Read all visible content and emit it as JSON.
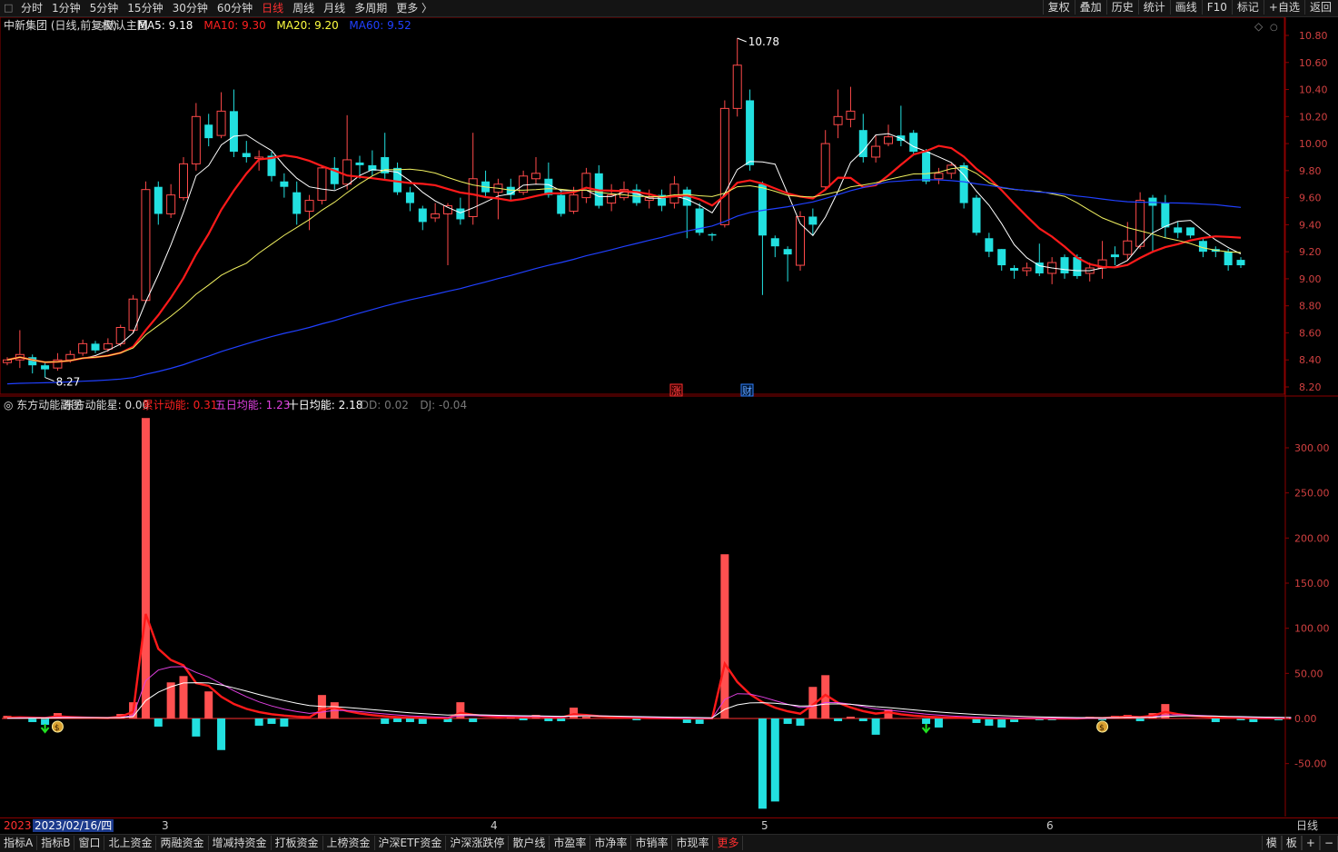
{
  "topbar": {
    "tabs": [
      {
        "label": "分时",
        "active": false
      },
      {
        "label": "1分钟",
        "active": false
      },
      {
        "label": "5分钟",
        "active": false
      },
      {
        "label": "15分钟",
        "active": false
      },
      {
        "label": "30分钟",
        "active": false
      },
      {
        "label": "60分钟",
        "active": false
      },
      {
        "label": "日线",
        "active": true
      },
      {
        "label": "周线",
        "active": false
      },
      {
        "label": "月线",
        "active": false
      },
      {
        "label": "多周期",
        "active": false
      },
      {
        "label": "更多 〉",
        "active": false
      }
    ],
    "right_buttons": [
      "复权",
      "叠加",
      "历史",
      "统计",
      "画线",
      "F10",
      "标记",
      "+自选",
      "返回"
    ]
  },
  "main_panel": {
    "stock_label": "中新集团 (日线,前复权)",
    "indicator_name": "默认主图",
    "ma": [
      {
        "label": "MA5: 9.18",
        "color": "#ffffff"
      },
      {
        "label": "MA10: 9.30",
        "color": "#ff2020"
      },
      {
        "label": "MA20: 9.20",
        "color": "#ffff40"
      },
      {
        "label": "MA60: 9.52",
        "color": "#2040ff"
      }
    ],
    "yaxis": [
      "10.80",
      "10.60",
      "10.40",
      "10.20",
      "10.00",
      "9.80",
      "9.60",
      "9.40",
      "9.20",
      "9.00",
      "8.80",
      "8.60",
      "8.40",
      "8.20"
    ],
    "high_label": "10.78",
    "low_label": "8.27",
    "event_badges": [
      "涨",
      "财"
    ]
  },
  "sub_panel": {
    "name": "东方动能副图",
    "values": [
      {
        "label": "东方动能星: 0.00",
        "color": "#dddddd"
      },
      {
        "label": "累计动能: 0.31",
        "color": "#ff2020"
      },
      {
        "label": "五日均能: 1.23",
        "color": "#e040e0"
      },
      {
        "label": "十日均能: 2.18",
        "color": "#ffffff"
      },
      {
        "label": "DD: 0.02",
        "color": "#777777"
      },
      {
        "label": "DJ: -0.04",
        "color": "#777777"
      }
    ],
    "yaxis": [
      "300.00",
      "250.00",
      "200.00",
      "150.00",
      "100.00",
      "50.00",
      "0.00",
      "-50.00"
    ]
  },
  "xaxis": {
    "year": "2023",
    "selected_date": "2023/02/16/四",
    "months": [
      "3",
      "4",
      "5",
      "6"
    ],
    "period_label": "日线"
  },
  "bottombar": {
    "items": [
      "指标A",
      "指标B",
      "窗口",
      "北上资金",
      "两融资金",
      "增减持资金",
      "打板资金",
      "上榜资金",
      "沪深ETF资金",
      "沪深涨跌停",
      "散户线",
      "市盈率",
      "市净率",
      "市销率",
      "市现率",
      "更多"
    ],
    "right": [
      "模",
      "板",
      "+",
      "−"
    ]
  },
  "chart_data": [
    {
      "type": "candlestick",
      "title": "中新集团 (日线,前复权)",
      "ylim": [
        8.15,
        10.9
      ],
      "candles": [
        [
          8.38,
          8.4,
          8.36,
          8.42
        ],
        [
          8.4,
          8.44,
          8.34,
          8.62
        ],
        [
          8.42,
          8.36,
          8.3,
          8.44
        ],
        [
          8.36,
          8.33,
          8.27,
          8.38
        ],
        [
          8.34,
          8.4,
          8.32,
          8.45
        ],
        [
          8.4,
          8.44,
          8.38,
          8.47
        ],
        [
          8.45,
          8.52,
          8.43,
          8.55
        ],
        [
          8.52,
          8.47,
          8.45,
          8.54
        ],
        [
          8.48,
          8.52,
          8.46,
          8.56
        ],
        [
          8.52,
          8.64,
          8.5,
          8.66
        ],
        [
          8.62,
          8.85,
          8.6,
          8.88
        ],
        [
          8.84,
          9.66,
          8.82,
          9.72
        ],
        [
          9.68,
          9.48,
          9.4,
          9.72
        ],
        [
          9.48,
          9.62,
          9.45,
          9.7
        ],
        [
          9.6,
          9.85,
          9.58,
          9.9
        ],
        [
          9.85,
          10.2,
          9.8,
          10.3
        ],
        [
          10.14,
          10.04,
          9.98,
          10.22
        ],
        [
          10.06,
          10.24,
          10.04,
          10.38
        ],
        [
          10.24,
          9.94,
          9.9,
          10.4
        ],
        [
          9.93,
          9.9,
          9.86,
          10.02
        ],
        [
          9.9,
          9.9,
          9.8,
          9.95
        ],
        [
          9.91,
          9.76,
          9.72,
          9.94
        ],
        [
          9.72,
          9.68,
          9.6,
          9.78
        ],
        [
          9.64,
          9.48,
          9.4,
          9.72
        ],
        [
          9.5,
          9.58,
          9.36,
          9.62
        ],
        [
          9.58,
          9.82,
          9.55,
          9.84
        ],
        [
          9.82,
          9.7,
          9.66,
          9.9
        ],
        [
          9.7,
          9.88,
          9.66,
          10.21
        ],
        [
          9.86,
          9.84,
          9.74,
          9.91
        ],
        [
          9.84,
          9.8,
          9.76,
          9.95
        ],
        [
          9.9,
          9.78,
          9.74,
          10.08
        ],
        [
          9.82,
          9.64,
          9.62,
          9.86
        ],
        [
          9.64,
          9.56,
          9.5,
          9.68
        ],
        [
          9.52,
          9.42,
          9.36,
          9.54
        ],
        [
          9.45,
          9.48,
          9.42,
          9.56
        ],
        [
          9.48,
          9.54,
          9.1,
          9.56
        ],
        [
          9.52,
          9.44,
          9.4,
          9.6
        ],
        [
          9.46,
          9.74,
          9.4,
          10.08
        ],
        [
          9.72,
          9.64,
          9.6,
          9.8
        ],
        [
          9.64,
          9.7,
          9.44,
          9.74
        ],
        [
          9.68,
          9.62,
          9.58,
          9.74
        ],
        [
          9.64,
          9.76,
          9.62,
          9.8
        ],
        [
          9.74,
          9.78,
          9.7,
          9.9
        ],
        [
          9.74,
          9.62,
          9.6,
          9.86
        ],
        [
          9.62,
          9.48,
          9.46,
          9.66
        ],
        [
          9.5,
          9.62,
          9.48,
          9.68
        ],
        [
          9.6,
          9.78,
          9.56,
          9.82
        ],
        [
          9.78,
          9.54,
          9.52,
          9.84
        ],
        [
          9.56,
          9.62,
          9.5,
          9.7
        ],
        [
          9.6,
          9.66,
          9.58,
          9.72
        ],
        [
          9.66,
          9.56,
          9.54,
          9.7
        ],
        [
          9.58,
          9.6,
          9.52,
          9.66
        ],
        [
          9.62,
          9.54,
          9.5,
          9.66
        ],
        [
          9.56,
          9.7,
          9.52,
          9.76
        ],
        [
          9.66,
          9.54,
          9.3,
          9.68
        ],
        [
          9.52,
          9.34,
          9.32,
          9.56
        ],
        [
          9.33,
          9.32,
          9.28,
          9.34
        ],
        [
          9.4,
          10.26,
          9.38,
          10.32
        ],
        [
          10.26,
          10.58,
          10.2,
          10.78
        ],
        [
          10.32,
          9.84,
          9.8,
          10.4
        ],
        [
          9.7,
          9.32,
          8.88,
          9.72
        ],
        [
          9.3,
          9.24,
          9.16,
          9.32
        ],
        [
          9.22,
          9.18,
          8.98,
          9.24
        ],
        [
          9.1,
          9.46,
          9.06,
          9.5
        ],
        [
          9.46,
          9.4,
          9.32,
          9.52
        ],
        [
          9.68,
          10.0,
          9.65,
          10.1
        ],
        [
          10.14,
          10.2,
          10.04,
          10.4
        ],
        [
          10.18,
          10.24,
          10.12,
          10.42
        ],
        [
          10.1,
          9.9,
          9.86,
          10.22
        ],
        [
          9.9,
          9.98,
          9.86,
          10.06
        ],
        [
          10.0,
          10.05,
          9.98,
          10.14
        ],
        [
          10.06,
          10.02,
          9.98,
          10.28
        ],
        [
          10.08,
          9.94,
          9.92,
          10.1
        ],
        [
          9.94,
          9.72,
          9.7,
          9.96
        ],
        [
          9.74,
          9.78,
          9.7,
          9.82
        ],
        [
          9.78,
          9.84,
          9.74,
          9.86
        ],
        [
          9.84,
          9.56,
          9.52,
          9.86
        ],
        [
          9.6,
          9.34,
          9.32,
          9.62
        ],
        [
          9.3,
          9.2,
          9.16,
          9.34
        ],
        [
          9.22,
          9.1,
          9.06,
          9.22
        ],
        [
          9.08,
          9.06,
          9.0,
          9.1
        ],
        [
          9.06,
          9.08,
          9.02,
          9.12
        ],
        [
          9.12,
          9.04,
          9.02,
          9.26
        ],
        [
          9.04,
          9.12,
          8.96,
          9.16
        ],
        [
          9.16,
          9.04,
          9.0,
          9.18
        ],
        [
          9.16,
          9.02,
          9.0,
          9.18
        ],
        [
          9.04,
          9.08,
          8.98,
          9.12
        ],
        [
          9.08,
          9.14,
          9.0,
          9.28
        ],
        [
          9.18,
          9.16,
          9.1,
          9.24
        ],
        [
          9.18,
          9.28,
          9.14,
          9.42
        ],
        [
          9.24,
          9.58,
          9.22,
          9.64
        ],
        [
          9.6,
          9.54,
          9.2,
          9.62
        ],
        [
          9.56,
          9.38,
          9.3,
          9.62
        ],
        [
          9.38,
          9.34,
          9.3,
          9.42
        ],
        [
          9.38,
          9.32,
          9.3,
          9.38
        ],
        [
          9.28,
          9.2,
          9.16,
          9.3
        ],
        [
          9.22,
          9.2,
          9.16,
          9.24
        ],
        [
          9.2,
          9.1,
          9.06,
          9.22
        ],
        [
          9.14,
          9.1,
          9.08,
          9.16
        ]
      ]
    },
    {
      "type": "bar",
      "title": "东方动能副图",
      "ylim": [
        -100,
        340
      ],
      "values": [
        3,
        2,
        -4,
        -7,
        6,
        0,
        0,
        0,
        0,
        5,
        18,
        333,
        -9,
        40,
        47,
        -20,
        30,
        -35,
        0,
        0,
        -8,
        -6,
        -9,
        0,
        0,
        26,
        18,
        0,
        0,
        0,
        -6,
        -4,
        -4,
        -6,
        0,
        -4,
        18,
        -4,
        0,
        0,
        3,
        -2,
        4,
        -3,
        -3,
        12,
        2,
        0,
        0,
        0,
        -2,
        0,
        0,
        0,
        -5,
        -6,
        0,
        182,
        0,
        0,
        -100,
        -92,
        -6,
        -8,
        35,
        48,
        -3,
        2,
        -3,
        -18,
        10,
        0,
        0,
        -6,
        -10,
        0,
        0,
        -5,
        -8,
        -10,
        -4,
        0,
        -2,
        -2,
        0,
        0,
        2,
        -2,
        3,
        4,
        -3,
        6,
        16,
        0,
        0,
        0,
        -4,
        0,
        -2,
        -4,
        0,
        -2,
        0
      ],
      "markers": {
        "down_arrow": [
          3,
          73
        ],
        "money": [
          4,
          87
        ]
      }
    }
  ]
}
